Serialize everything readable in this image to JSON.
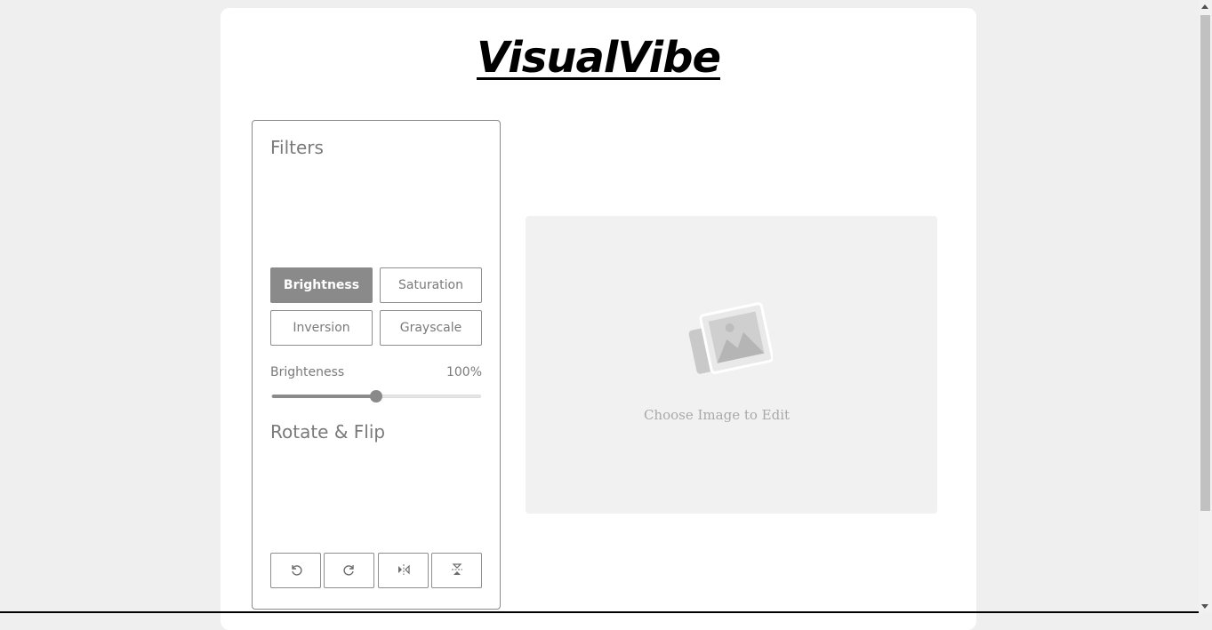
{
  "app": {
    "title": "VisualVibe"
  },
  "filters": {
    "title": "Filters",
    "buttons": [
      {
        "label": "Brightness",
        "active": true
      },
      {
        "label": "Saturation",
        "active": false
      },
      {
        "label": "Inversion",
        "active": false
      },
      {
        "label": "Grayscale",
        "active": false
      }
    ],
    "slider": {
      "label": "Brighteness",
      "value_text": "100%",
      "fraction": 0.5
    }
  },
  "rotate": {
    "title": "Rotate & Flip",
    "buttons": [
      {
        "icon": "rotate-left-icon"
      },
      {
        "icon": "rotate-right-icon"
      },
      {
        "icon": "flip-horizontal-icon"
      },
      {
        "icon": "flip-vertical-icon"
      }
    ]
  },
  "preview": {
    "placeholder_text": "Choose Image to Edit",
    "icon": "image-placeholder-icon"
  },
  "colors": {
    "accent": "#8a8a8a",
    "background": "#efefef",
    "preview_bg": "#f1f1f1"
  }
}
